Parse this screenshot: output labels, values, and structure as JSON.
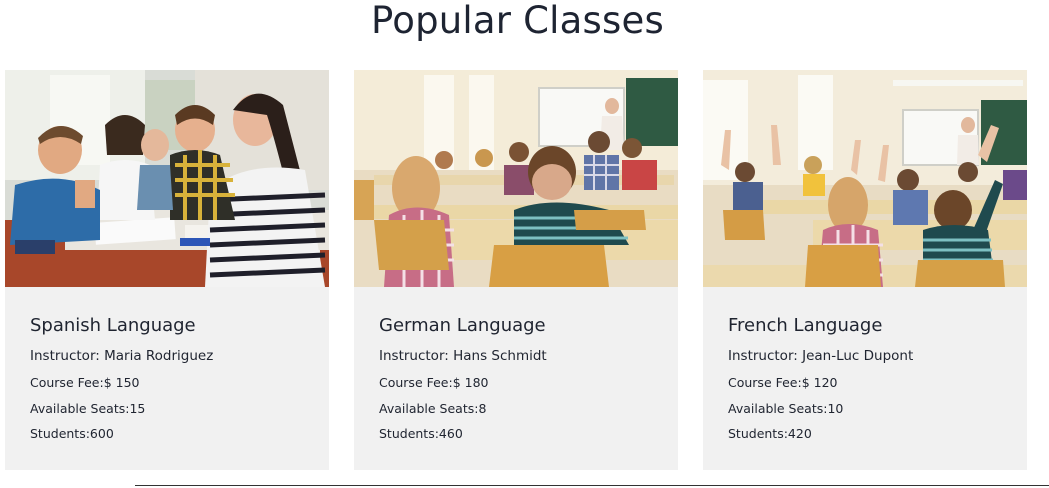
{
  "section": {
    "title": "Popular Classes"
  },
  "classes": [
    {
      "title": "Spanish Language",
      "instructor": "Instructor: Maria Rodriguez",
      "fee": "Course Fee:$ 150",
      "seats": "Available Seats:15",
      "students": "Students:600",
      "image_alt": "teacher-with-kids-at-table-photo"
    },
    {
      "title": "German Language",
      "instructor": "Instructor: Hans Schmidt",
      "fee": "Course Fee:$ 180",
      "seats": "Available Seats:8",
      "students": "Students:460",
      "image_alt": "classroom-back-view-photo"
    },
    {
      "title": "French Language",
      "instructor": "Instructor: Jean-Luc Dupont",
      "fee": "Course Fee:$ 120",
      "seats": "Available Seats:10",
      "students": "Students:420",
      "image_alt": "classroom-hands-raised-photo"
    }
  ],
  "colors": {
    "card_bg": "#f1f1f1",
    "title": "#1e2432",
    "text": "#1f2430"
  }
}
